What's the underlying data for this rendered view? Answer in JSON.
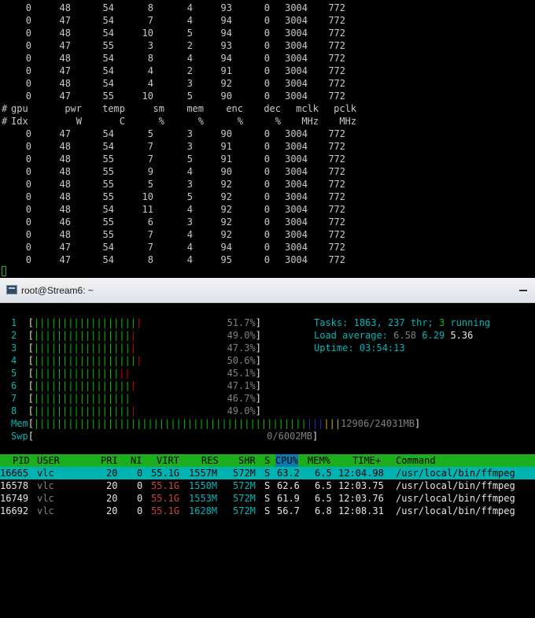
{
  "dmon": {
    "rows_before": [
      [
        "0",
        "48",
        "54",
        "8",
        "4",
        "93",
        "0",
        "3004",
        "772"
      ],
      [
        "0",
        "47",
        "54",
        "7",
        "4",
        "94",
        "0",
        "3004",
        "772"
      ],
      [
        "0",
        "48",
        "54",
        "10",
        "5",
        "94",
        "0",
        "3004",
        "772"
      ],
      [
        "0",
        "47",
        "55",
        "3",
        "2",
        "93",
        "0",
        "3004",
        "772"
      ],
      [
        "0",
        "48",
        "54",
        "8",
        "4",
        "94",
        "0",
        "3004",
        "772"
      ],
      [
        "0",
        "47",
        "54",
        "4",
        "2",
        "91",
        "0",
        "3004",
        "772"
      ],
      [
        "0",
        "48",
        "54",
        "4",
        "3",
        "92",
        "0",
        "3004",
        "772"
      ],
      [
        "0",
        "47",
        "55",
        "10",
        "5",
        "90",
        "0",
        "3004",
        "772"
      ]
    ],
    "header1": [
      "gpu",
      "pwr",
      "temp",
      "sm",
      "mem",
      "enc",
      "dec",
      "mclk",
      "pclk"
    ],
    "header2": [
      "Idx",
      "W",
      "C",
      "%",
      "%",
      "%",
      "%",
      "MHz",
      "MHz"
    ],
    "rows_after": [
      [
        "0",
        "47",
        "54",
        "5",
        "3",
        "90",
        "0",
        "3004",
        "772"
      ],
      [
        "0",
        "48",
        "54",
        "7",
        "3",
        "91",
        "0",
        "3004",
        "772"
      ],
      [
        "0",
        "48",
        "55",
        "7",
        "5",
        "91",
        "0",
        "3004",
        "772"
      ],
      [
        "0",
        "48",
        "55",
        "9",
        "4",
        "90",
        "0",
        "3004",
        "772"
      ],
      [
        "0",
        "48",
        "55",
        "5",
        "3",
        "92",
        "0",
        "3004",
        "772"
      ],
      [
        "0",
        "48",
        "55",
        "10",
        "5",
        "92",
        "0",
        "3004",
        "772"
      ],
      [
        "0",
        "48",
        "54",
        "11",
        "4",
        "92",
        "0",
        "3004",
        "772"
      ],
      [
        "0",
        "46",
        "55",
        "6",
        "3",
        "92",
        "0",
        "3004",
        "772"
      ],
      [
        "0",
        "48",
        "55",
        "7",
        "4",
        "92",
        "0",
        "3004",
        "772"
      ],
      [
        "0",
        "47",
        "54",
        "7",
        "4",
        "94",
        "0",
        "3004",
        "772"
      ],
      [
        "0",
        "47",
        "54",
        "8",
        "4",
        "95",
        "0",
        "3004",
        "772"
      ]
    ]
  },
  "window": {
    "title": "root@Stream6: ~",
    "icon": "terminal-icon"
  },
  "htop": {
    "cpus": [
      {
        "num": "1",
        "green": 18,
        "red": 1,
        "pct": "51.7%"
      },
      {
        "num": "2",
        "green": 17,
        "red": 1,
        "pct": "49.0%"
      },
      {
        "num": "3",
        "green": 17,
        "red": 1,
        "pct": "47.3%"
      },
      {
        "num": "4",
        "green": 18,
        "red": 1,
        "pct": "50.6%"
      },
      {
        "num": "5",
        "green": 15,
        "red": 2,
        "pct": "45.1%"
      },
      {
        "num": "6",
        "green": 17,
        "red": 1,
        "pct": "47.1%"
      },
      {
        "num": "7",
        "green": 17,
        "red": 0,
        "pct": "46.7%"
      },
      {
        "num": "8",
        "green": 17,
        "red": 1,
        "pct": "49.0%"
      }
    ],
    "mem": {
      "label": "Mem",
      "green": 48,
      "blue": 3,
      "yellow": 3,
      "value": "12906/24031MB"
    },
    "swp": {
      "label": "Swp",
      "value": "0/6002MB"
    },
    "tasks_label": "Tasks:",
    "tasks": "1863,",
    "thr": "237",
    "thr_label": "thr;",
    "running": "3",
    "running_label": "running",
    "load_label": "Load average:",
    "load1": "6.58",
    "load5": "6.29",
    "load15": "5.36",
    "uptime_label": "Uptime:",
    "uptime": "03:54:13",
    "columns": {
      "pid": "PID",
      "user": "USER",
      "pri": "PRI",
      "ni": "NI",
      "virt": "VIRT",
      "res": "RES",
      "shr": "SHR",
      "s": "S",
      "cpu": "CPU%",
      "mem": "MEM%",
      "time": "TIME+",
      "command": "Command"
    },
    "processes": [
      {
        "pid": "16665",
        "user": "vlc",
        "pri": "20",
        "ni": "0",
        "virt": "55.1G",
        "res": "1557M",
        "shr": "572M",
        "s": "S",
        "cpu": "63.2",
        "mem": "6.5",
        "time": "12:04.98",
        "command": "/usr/local/bin/ffmpeg"
      },
      {
        "pid": "16578",
        "user": "vlc",
        "pri": "20",
        "ni": "0",
        "virt": "55.1G",
        "res": "1550M",
        "shr": "572M",
        "s": "S",
        "cpu": "62.6",
        "mem": "6.5",
        "time": "12:03.75",
        "command": "/usr/local/bin/ffmpeg"
      },
      {
        "pid": "16749",
        "user": "vlc",
        "pri": "20",
        "ni": "0",
        "virt": "55.1G",
        "res": "1553M",
        "shr": "572M",
        "s": "S",
        "cpu": "61.9",
        "mem": "6.5",
        "time": "12:03.76",
        "command": "/usr/local/bin/ffmpeg"
      },
      {
        "pid": "16692",
        "user": "vlc",
        "pri": "20",
        "ni": "0",
        "virt": "55.1G",
        "res": "1628M",
        "shr": "572M",
        "s": "S",
        "cpu": "56.7",
        "mem": "6.8",
        "time": "12:08.31",
        "command": "/usr/local/bin/ffmpeg"
      }
    ],
    "colors": {
      "header_bg": "#1cae1c",
      "selected_bg": "#00b3b3",
      "cpu_col_bg": "#0a7ab0"
    }
  }
}
